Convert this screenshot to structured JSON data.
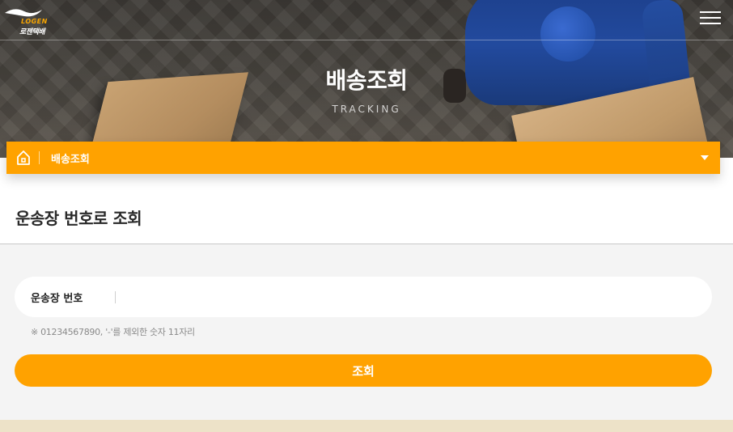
{
  "header": {
    "logo_word": "LOGEN",
    "logo_kr": "로젠택배",
    "menu_icon": "hamburger-menu-icon"
  },
  "hero": {
    "title": "배송조회",
    "subtitle": "TRACKING"
  },
  "breadcrumb": {
    "home_icon": "home-icon",
    "label": "배송조회",
    "caret_icon": "caret-down-icon"
  },
  "section": {
    "title": "운송장 번호로 조회"
  },
  "form": {
    "input_label": "운송장 번호",
    "input_value": "",
    "placeholder": "",
    "hint": "※ 01234567890, '-'를 제외한 숫자 11자리",
    "button_label": "조회"
  },
  "colors": {
    "accent": "#ffa200",
    "form_bg": "#f4f4f4",
    "bottom_strip": "#ede2c8"
  }
}
